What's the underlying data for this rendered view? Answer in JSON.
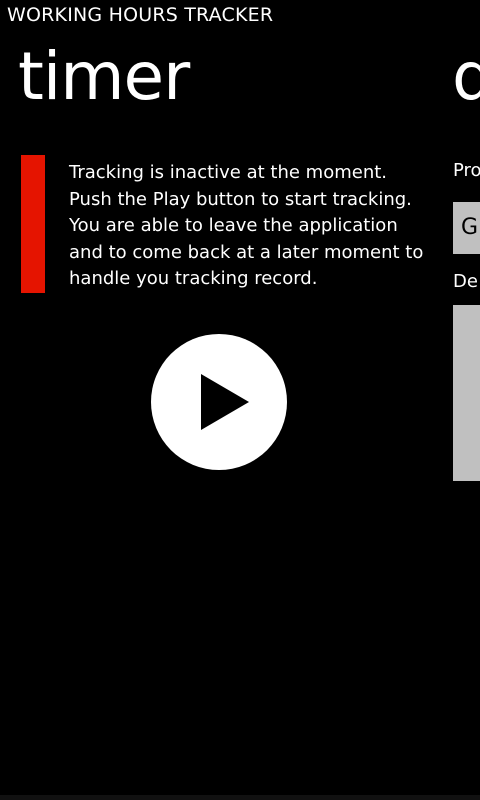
{
  "app": {
    "title": "WORKING HOURS TRACKER"
  },
  "pivot": {
    "current_header": "timer",
    "next_header_partial": "d"
  },
  "timer": {
    "status_color": "#e51400",
    "status_message": "Tracking is inactive at the moment.\nPush the Play button to start tracking.\nYou are able to leave the application\nand to come back at a later moment to\nhandle you tracking record.",
    "play_button_icon": "play-icon"
  },
  "details_preview": {
    "project_label_partial": "Pro",
    "project_value_partial": "G",
    "description_label_partial": "De"
  }
}
